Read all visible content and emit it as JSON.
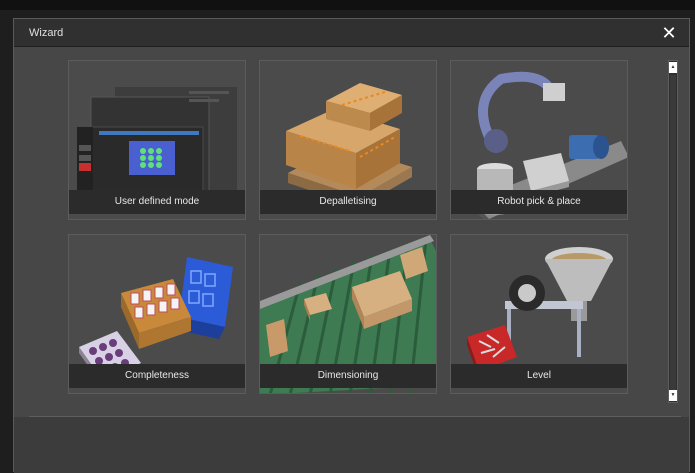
{
  "window": {
    "title": "Wizard"
  },
  "tiles": [
    {
      "label": "User defined mode"
    },
    {
      "label": "Depalletising"
    },
    {
      "label": "Robot pick & place"
    },
    {
      "label": "Completeness"
    },
    {
      "label": "Dimensioning"
    },
    {
      "label": "Level"
    }
  ],
  "icons": {
    "close": "close-icon",
    "scroll_up": "scroll-up-arrow",
    "scroll_down": "scroll-down-arrow"
  },
  "colors": {
    "dialog_bg": "#474747",
    "titlebar_bg": "#303030",
    "caption_bg": "#2b2b2b",
    "close_icon": "#ffffff"
  }
}
